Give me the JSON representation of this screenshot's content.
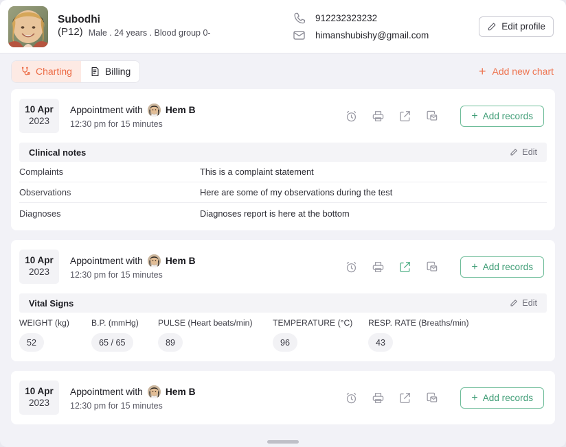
{
  "patient": {
    "name": "Subodhi",
    "id": "(P12)",
    "meta": "Male . 24 years . Blood group 0-",
    "phone": "912232323232",
    "email": "himanshubishy@gmail.com",
    "phone_icon": "phone-icon",
    "email_icon": "mail-icon",
    "avatar_alt": "patient-photo"
  },
  "header": {
    "edit_profile_label": "Edit profile",
    "edit_profile_icon": "pencil-icon"
  },
  "tabs": [
    {
      "label": "Charting",
      "icon": "stethoscope-icon",
      "active": true
    },
    {
      "label": "Billing",
      "icon": "invoice-icon",
      "active": false
    }
  ],
  "toolbar": {
    "add_new_chart_label": "Add new chart",
    "add_new_chart_icon": "plus-icon"
  },
  "colors": {
    "accent_orange": "#ee7450",
    "tab_active_bg": "#fdeae4",
    "accent_green": "#3f9d76",
    "page_bg": "#f2f2f7",
    "card_bg": "#ffffff",
    "section_bg": "#f4f4f7",
    "pill_bg": "#f2f2f5"
  },
  "action_icons": [
    {
      "name": "alarm-clock-icon",
      "label": "Reminder"
    },
    {
      "name": "printer-icon",
      "label": "Print"
    },
    {
      "name": "share-icon",
      "label": "Share"
    },
    {
      "name": "send-mail-icon",
      "label": "Send"
    }
  ],
  "add_records_label": "Add records",
  "edit_label": "Edit",
  "cards": [
    {
      "date_day": "10 Apr",
      "date_year": "2023",
      "appointment_prefix": "Appointment with",
      "doctor": "Hem B",
      "time": "12:30 pm for 15 minutes",
      "share_active": false,
      "section": {
        "title": "Clinical notes",
        "type": "notes",
        "rows": [
          {
            "label": "Complaints",
            "value": "This is a complaint statement"
          },
          {
            "label": "Observations",
            "value": "Here are some of my observations during the test"
          },
          {
            "label": "Diagnoses",
            "value": "Diagnoses report is here at the bottom"
          }
        ]
      }
    },
    {
      "date_day": "10 Apr",
      "date_year": "2023",
      "appointment_prefix": "Appointment with",
      "doctor": "Hem B",
      "time": "12:30 pm for 15 minutes",
      "share_active": true,
      "section": {
        "title": "Vital Signs",
        "type": "vitals",
        "columns": [
          "WEIGHT (kg)",
          "B.P. (mmHg)",
          "PULSE (Heart beats/min)",
          "TEMPERATURE (°C)",
          "RESP. RATE (Breaths/min)"
        ],
        "values": [
          "52",
          "65 / 65",
          "89",
          "96",
          "43"
        ]
      }
    },
    {
      "date_day": "10 Apr",
      "date_year": "2023",
      "appointment_prefix": "Appointment with",
      "doctor": "Hem B",
      "time": "12:30 pm for 15 minutes",
      "share_active": false,
      "section": null
    }
  ]
}
